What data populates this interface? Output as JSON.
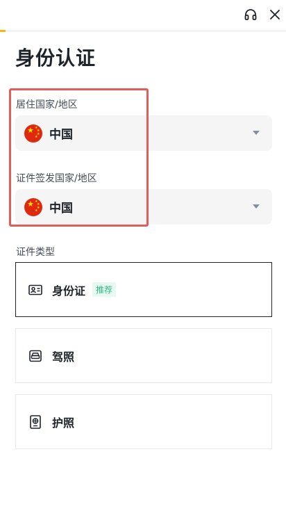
{
  "header": {
    "progress": 0.02,
    "accent_color": "#f0b90b",
    "icons": [
      "headset-icon",
      "close-icon"
    ]
  },
  "page": {
    "title": "身份认证"
  },
  "residence": {
    "label": "居住国家/地区",
    "value": "中国",
    "flag": "china-flag-icon"
  },
  "issuing": {
    "label": "证件签发国家/地区",
    "value": "中国",
    "flag": "china-flag-icon"
  },
  "documents": {
    "label": "证件类型",
    "options": [
      {
        "label": "身份证",
        "badge": "推荐",
        "icon": "id-card-icon",
        "selected": true
      },
      {
        "label": "驾照",
        "icon": "driver-license-icon",
        "selected": false
      },
      {
        "label": "护照",
        "icon": "passport-icon",
        "selected": false
      }
    ]
  },
  "annotation": {
    "highlight_color": "#e25c5c"
  }
}
